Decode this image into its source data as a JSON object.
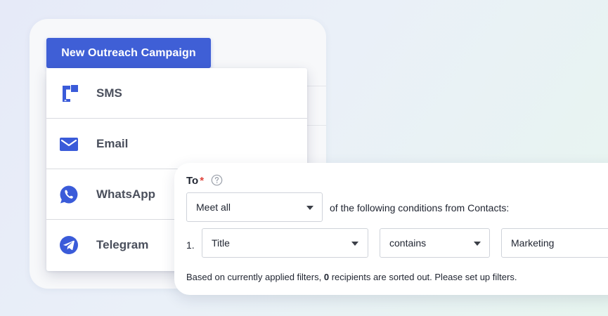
{
  "campaign_button": {
    "label": "New Outreach Campaign"
  },
  "channels": [
    {
      "label": "SMS",
      "icon": "sms-icon"
    },
    {
      "label": "Email",
      "icon": "email-icon"
    },
    {
      "label": "WhatsApp",
      "icon": "whatsapp-icon"
    },
    {
      "label": "Telegram",
      "icon": "telegram-icon"
    }
  ],
  "filters": {
    "to_label": "To",
    "required_mark": "*",
    "help_icon": "question-circle-icon",
    "match_select": {
      "value": "Meet all"
    },
    "conditions_text": "of the following conditions from Contacts:",
    "condition": {
      "index_label": "1.",
      "field_select": {
        "value": "Title"
      },
      "operator_select": {
        "value": "contains"
      },
      "value_input": {
        "value": "Marketing"
      }
    },
    "summary": {
      "prefix": "Based on currently applied filters,",
      "count": "0",
      "suffix": "recipients are sorted out. Please set up filters."
    }
  },
  "colors": {
    "accent": "#3f5fd6",
    "icon": "#3a5bd9",
    "required": "#e0443b"
  }
}
